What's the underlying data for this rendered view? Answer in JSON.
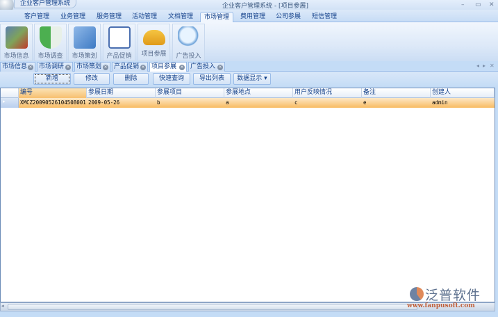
{
  "app": {
    "title": "企业客户管理系统",
    "window_title": "企业客户管理系统 - [项目参展]"
  },
  "window_controls": {
    "minimize": "–",
    "maximize": "▭",
    "close": "✕"
  },
  "menu": [
    "客户管理",
    "业务管理",
    "服务管理",
    "活动管理",
    "文档管理",
    "市场管理",
    "费用管理",
    "公司参展",
    "短信管理"
  ],
  "ribbon": [
    "市场信息",
    "市场调查",
    "市场策划",
    "产品促销",
    "项目参展",
    "广告投入"
  ],
  "doc_tabs": [
    "市场信息",
    "市场调研",
    "市场策划",
    "产品促销",
    "项目参展",
    "广告投入"
  ],
  "tab_nav": {
    "prev": "◂",
    "next": "▸",
    "close": "✕"
  },
  "toolbar": {
    "add": "新增",
    "edit": "修改",
    "delete": "删除",
    "quick_search": "快速查询",
    "export": "导出列表",
    "display": "数据显示",
    "display_arrow": "▾"
  },
  "grid": {
    "columns": [
      "编号",
      "参展日期",
      "参展项目",
      "参展地点",
      "用户反映情况",
      "备注",
      "创建人"
    ],
    "rows": [
      [
        "XMCZ20090526104508001",
        "2009-05-26",
        "b",
        "a",
        "c",
        "e",
        "admin"
      ]
    ]
  },
  "logo": {
    "brand": "泛普软件",
    "url": "www.fanpusoft.com"
  },
  "colors": {
    "selected_row": "#f8bb62",
    "accent": "#15428b"
  }
}
